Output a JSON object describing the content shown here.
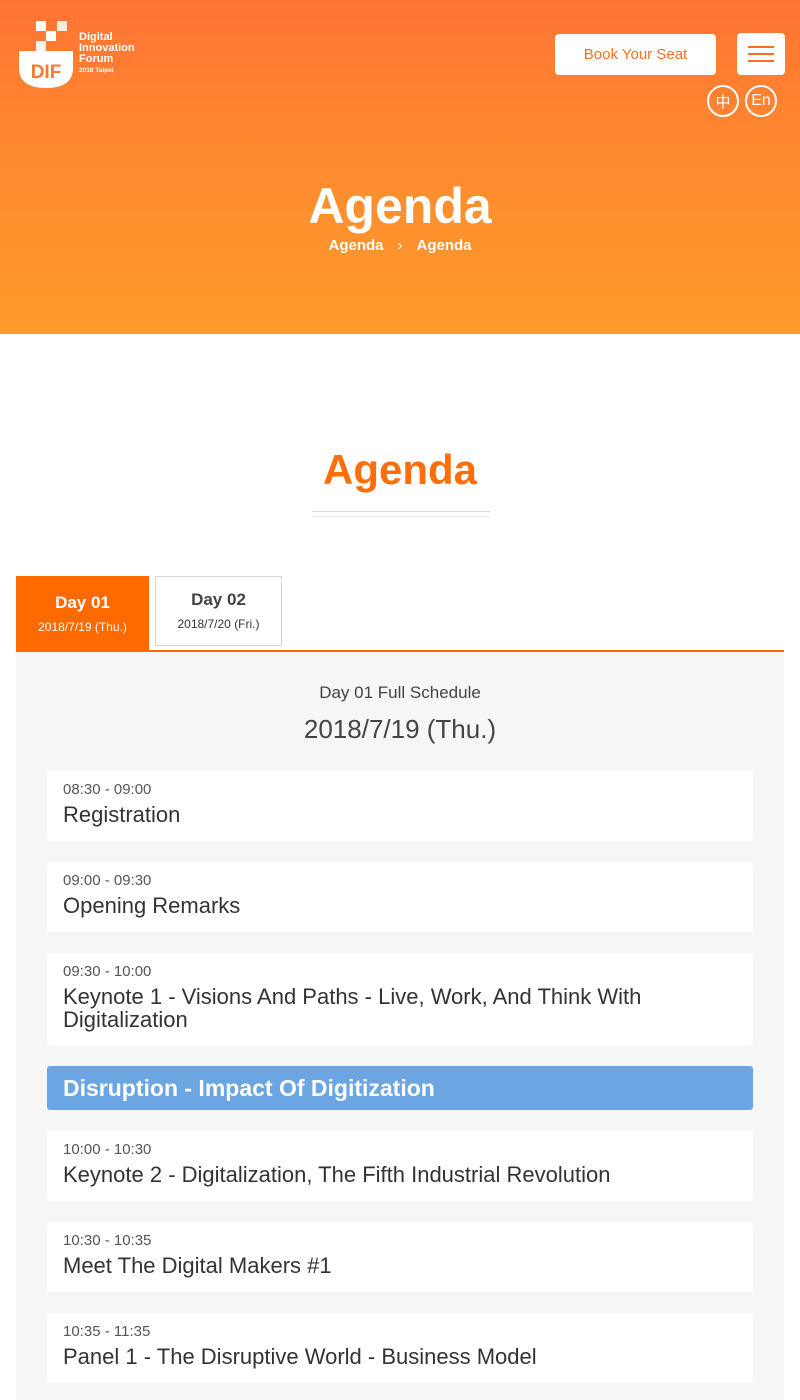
{
  "header": {
    "logo": {
      "mark_text": "DIF",
      "line1": "Digital",
      "line2": "Innovation",
      "line3": "Forum",
      "line4": "2018 Taipei"
    },
    "book_label": "Book Your Seat",
    "lang_zh": "中",
    "lang_en": "En"
  },
  "hero": {
    "title": "Agenda",
    "breadcrumb": [
      "Agenda",
      "›",
      "Agenda"
    ]
  },
  "section": {
    "title": "Agenda"
  },
  "tabs": [
    {
      "day": "Day 01",
      "date": "2018/7/19 (Thu.)",
      "active": true
    },
    {
      "day": "Day 02",
      "date": "2018/7/20 (Fri.)",
      "active": false
    }
  ],
  "schedule": {
    "subtitle": "Day 01 Full Schedule",
    "date": "2018/7/19 (Thu.)",
    "items": [
      {
        "time": "08:30 - 09:00",
        "title": "Registration"
      },
      {
        "time": "09:00 - 09:30",
        "title": "Opening Remarks"
      },
      {
        "time": "09:30 - 10:00",
        "title": "Keynote 1 - Visions And Paths - Live, Work, And Think With Digitalization"
      },
      {
        "time": "10:00 - 10:30",
        "title": "Keynote 2 - Digitalization, The Fifth Industrial Revolution"
      },
      {
        "time": "10:30 - 10:35",
        "title": "Meet The Digital Makers #1"
      },
      {
        "time": "10:35 - 11:35",
        "title": "Panel 1 - The Disruptive World - Business Model"
      }
    ],
    "category": "Disruption - Impact Of Digitization"
  },
  "colors": {
    "brand_orange": "#ff6a00",
    "category_blue": "#6ba6e3",
    "panel_bg": "#f6f6f6"
  }
}
